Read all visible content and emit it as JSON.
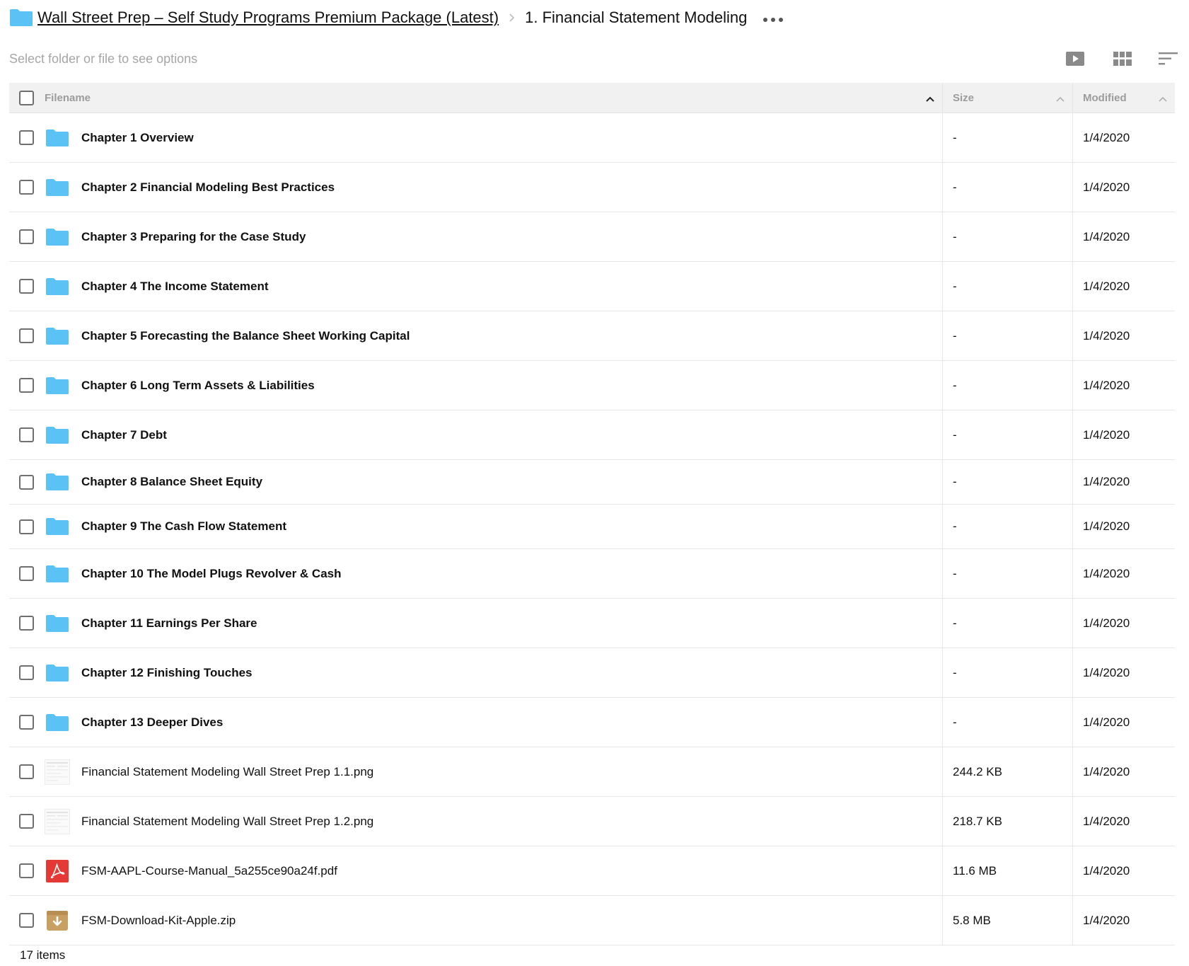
{
  "breadcrumb": {
    "root_label": "Wall Street Prep – Self Study Programs Premium Package (Latest)",
    "current_label": "1. Financial Statement Modeling",
    "folder_icon": "folder-icon",
    "more_icon": "more-horizontal-icon"
  },
  "toolbar": {
    "hint": "Select folder or file to see options",
    "icons": [
      "play-icon",
      "grid-view-icon",
      "sort-icon"
    ]
  },
  "table": {
    "columns": {
      "filename": "Filename",
      "size": "Size",
      "modified": "Modified"
    },
    "rows": [
      {
        "name": "Chapter 1 Overview",
        "size": "-",
        "modified": "1/4/2020",
        "type": "folder"
      },
      {
        "name": "Chapter 2 Financial Modeling Best Practices",
        "size": "-",
        "modified": "1/4/2020",
        "type": "folder"
      },
      {
        "name": "Chapter 3 Preparing for the Case Study",
        "size": "-",
        "modified": "1/4/2020",
        "type": "folder"
      },
      {
        "name": "Chapter 4 The Income Statement",
        "size": "-",
        "modified": "1/4/2020",
        "type": "folder"
      },
      {
        "name": "Chapter 5 Forecasting the Balance Sheet Working Capital",
        "size": "-",
        "modified": "1/4/2020",
        "type": "folder"
      },
      {
        "name": "Chapter 6 Long Term Assets & Liabilities",
        "size": "-",
        "modified": "1/4/2020",
        "type": "folder"
      },
      {
        "name": "Chapter 7 Debt",
        "size": "-",
        "modified": "1/4/2020",
        "type": "folder"
      },
      {
        "name": "Chapter 8 Balance Sheet Equity",
        "size": "-",
        "modified": "1/4/2020",
        "type": "folder"
      },
      {
        "name": "Chapter 9 The Cash Flow Statement",
        "size": "-",
        "modified": "1/4/2020",
        "type": "folder"
      },
      {
        "name": "Chapter 10 The Model Plugs Revolver & Cash",
        "size": "-",
        "modified": "1/4/2020",
        "type": "folder"
      },
      {
        "name": "Chapter 11 Earnings Per Share",
        "size": "-",
        "modified": "1/4/2020",
        "type": "folder"
      },
      {
        "name": "Chapter 12 Finishing Touches",
        "size": "-",
        "modified": "1/4/2020",
        "type": "folder"
      },
      {
        "name": "Chapter 13 Deeper Dives",
        "size": "-",
        "modified": "1/4/2020",
        "type": "folder"
      },
      {
        "name": "Financial Statement Modeling Wall Street Prep 1.1.png",
        "size": "244.2 KB",
        "modified": "1/4/2020",
        "type": "image"
      },
      {
        "name": "Financial Statement Modeling Wall Street Prep 1.2.png",
        "size": "218.7 KB",
        "modified": "1/4/2020",
        "type": "image"
      },
      {
        "name": "FSM-AAPL-Course-Manual_5a255ce90a24f.pdf",
        "size": "11.6 MB",
        "modified": "1/4/2020",
        "type": "pdf"
      },
      {
        "name": "FSM-Download-Kit-Apple.zip",
        "size": "5.8 MB",
        "modified": "1/4/2020",
        "type": "zip"
      }
    ]
  },
  "footer": {
    "count": "17 items"
  },
  "colors": {
    "folder": "#5bc2f5",
    "header_bg": "#f1f1f1",
    "hint": "#a6a6a6",
    "pdf": "#e53935",
    "zip": "#c9a063"
  }
}
